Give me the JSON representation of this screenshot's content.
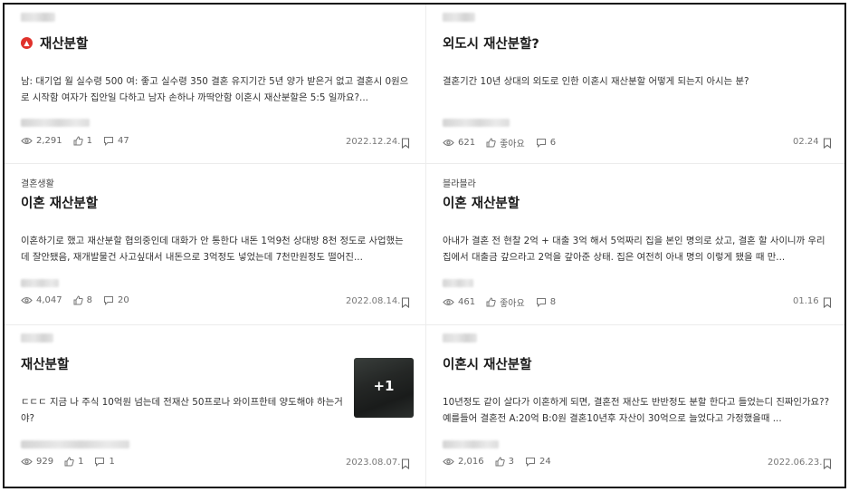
{
  "posts": [
    {
      "category": "",
      "title": "재산분할",
      "excerpt": "남: 대기업 월 실수령 500 여: 좋고 실수령 350 결혼 유지기간 5년 양가 받은거 없고 결혼시 0원으로 시작함 여자가 집안일 다하고 남자 손하나 까딱안함 이혼시 재산분할은 5:5 일까요?...",
      "views": "2,291",
      "likes": "1",
      "comments": "47",
      "date": "2022.12.24.",
      "brand_icon": "red-circle-icon"
    },
    {
      "category": "",
      "title": "외도시 재산분할?",
      "excerpt": "결혼기간 10년 상대의 외도로 인한 이혼시 재산분할 어떻게 되는지 아시는 분?",
      "views": "621",
      "likes": "좋아요",
      "comments": "6",
      "date": "02.24"
    },
    {
      "category": "결혼생활",
      "title": "이혼 재산분할",
      "excerpt": "이혼하기로 했고 재산분할 협의중인데 대화가 안 통한다 내돈 1억9천 상대방 8천 정도로 사업했는데 잘안됐음, 재개발물건 사고싶대서 내돈으로 3억정도 넣었는데 7천만원정도 떨어진...",
      "views": "4,047",
      "likes": "8",
      "comments": "20",
      "date": "2022.08.14."
    },
    {
      "category": "블라블라",
      "title": "이혼 재산분할",
      "excerpt": "아내가 결혼 전 현찰 2억 + 대출 3억 해서 5억짜리 집을 본인 명의로 샀고, 결혼 할 사이니까 우리 집에서 대출금 갚으라고 2억을 갚아준 상태. 집은 여전히 아내 명의 이렇게 됐을 때 만...",
      "views": "461",
      "likes": "좋아요",
      "comments": "8",
      "date": "01.16"
    },
    {
      "category": "",
      "title": "재산분할",
      "excerpt": "ㄷㄷㄷ 지금 나 주식 10억원 넘는데 전재산 50프로나 와이프한테 양도해야 하는거야?",
      "views": "929",
      "likes": "1",
      "comments": "1",
      "date": "2023.08.07.",
      "thumb_more": "+1"
    },
    {
      "category": "",
      "title": "이혼시 재산분할",
      "excerpt": "10년정도 같이 살다가 이혼하게 되면, 결혼전 재산도 반반정도 분할 한다고 들었는디 진짜인가요?? 예를들어 결혼전 A:20억 B:0원 결혼10년후 자산이 30억으로 늘었다고 가정했을때 ...",
      "views": "2,016",
      "likes": "3",
      "comments": "24",
      "date": "2022.06.23."
    }
  ],
  "icons": {
    "views": "eye-icon",
    "likes": "thumbs-up-icon",
    "comments": "comment-bubble-icon",
    "bookmark": "bookmark-icon"
  },
  "colors": {
    "brand": "#e0312b",
    "text": "#1a1a1a",
    "muted": "#666666"
  }
}
